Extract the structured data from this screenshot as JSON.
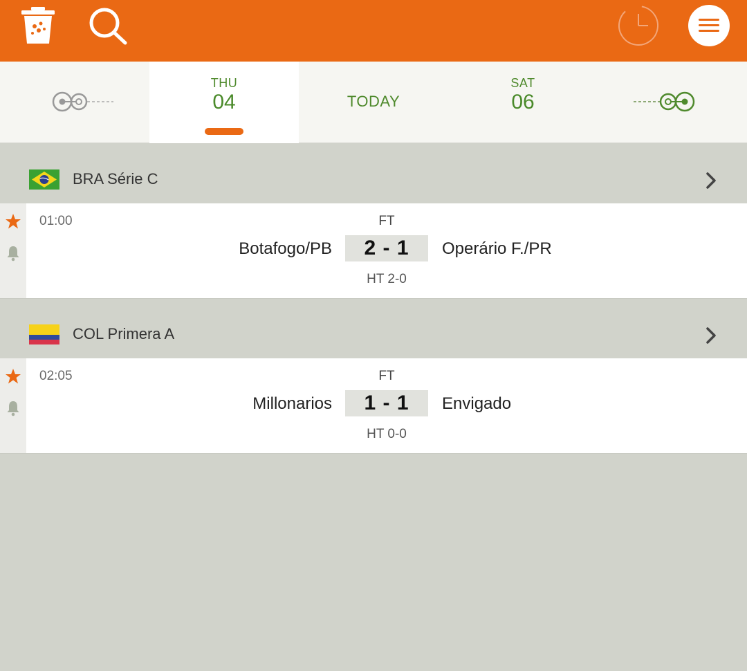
{
  "topbar": {
    "icons": [
      "trash-icon",
      "search-icon",
      "clock-icon",
      "menu-icon"
    ],
    "colors": {
      "bar": "#ea6914"
    }
  },
  "datebar": {
    "prev": {
      "day": "THU",
      "date": "04"
    },
    "today": "TODAY",
    "next": {
      "day": "SAT",
      "date": "06"
    }
  },
  "leagues": [
    {
      "name": "BRA Série C",
      "flag": "brazil-flag-icon",
      "match": {
        "time": "01:00",
        "status": "FT",
        "home": "Botafogo/PB",
        "score": "2 - 1",
        "away": "Operário F./PR",
        "ht": "HT 2-0"
      }
    },
    {
      "name": "COL Primera A",
      "flag": "colombia-flag-icon",
      "match": {
        "time": "02:05",
        "status": "FT",
        "home": "Millonarios",
        "score": "1 - 1",
        "away": "Envigado",
        "ht": "HT 0-0"
      }
    }
  ]
}
